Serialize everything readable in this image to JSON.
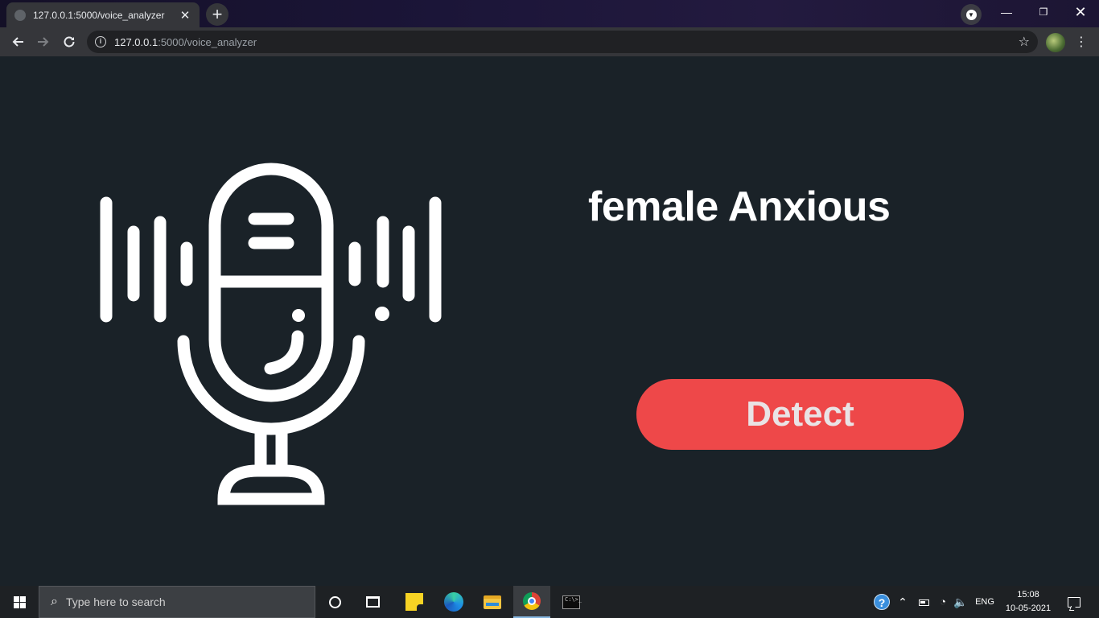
{
  "browser": {
    "tab_title": "127.0.0.1:5000/voice_analyzer",
    "tab_close": "✕",
    "new_tab": "+",
    "url_host": "127.0.0.1",
    "url_path": ":5000/voice_analyzer",
    "icons": {
      "back": "arrow-left",
      "forward": "arrow-right",
      "reload": "reload",
      "info": "info",
      "bookmark": "star",
      "menu": "more-vert",
      "profile_dropdown": "chevron-down"
    }
  },
  "window_controls": {
    "minimize": "—",
    "maximize": "❐",
    "close": "✕"
  },
  "page": {
    "result": "female Anxious",
    "detect_label": "Detect",
    "colors": {
      "background": "#1a2228",
      "button": "#ee4849",
      "button_text": "#e9e3e5",
      "mic": "#ffffff"
    },
    "mic_icon": "microphone-with-sound-waves"
  },
  "taskbar": {
    "search_placeholder": "Type here to search",
    "apps": [
      "cortana",
      "task-view",
      "sticky-notes",
      "edge",
      "file-explorer",
      "chrome",
      "terminal"
    ],
    "active_app": "chrome",
    "tray": {
      "language": "ENG",
      "time": "15:08",
      "date": "10-05-2021"
    }
  }
}
